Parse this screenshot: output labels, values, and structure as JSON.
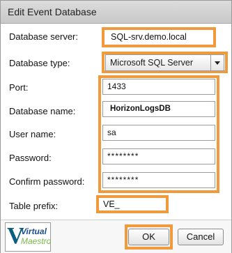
{
  "dialog": {
    "title": "Edit Event Database"
  },
  "form": {
    "database_server": {
      "label": "Database server:",
      "value": "SQL-srv.demo.local"
    },
    "database_type": {
      "label": "Database type:",
      "value": "Microsoft SQL Server"
    },
    "port": {
      "label": "Port:",
      "value": "1433"
    },
    "database_name": {
      "label": "Database name:",
      "value": "HorizonLogsDB"
    },
    "user_name": {
      "label": "User name:",
      "value": "sa"
    },
    "password": {
      "label": "Password:",
      "value": "********"
    },
    "confirm_password": {
      "label": "Confirm password:",
      "value": "********"
    },
    "table_prefix": {
      "label": "Table prefix:",
      "value": "VE_"
    }
  },
  "footer": {
    "logo": {
      "line1": "Virtual",
      "line2": "Maestro"
    },
    "ok_label": "OK",
    "cancel_label": "Cancel"
  },
  "colors": {
    "highlight": "#f09a3e",
    "logo_primary": "#1b4f8a",
    "logo_secondary": "#7ab648"
  }
}
